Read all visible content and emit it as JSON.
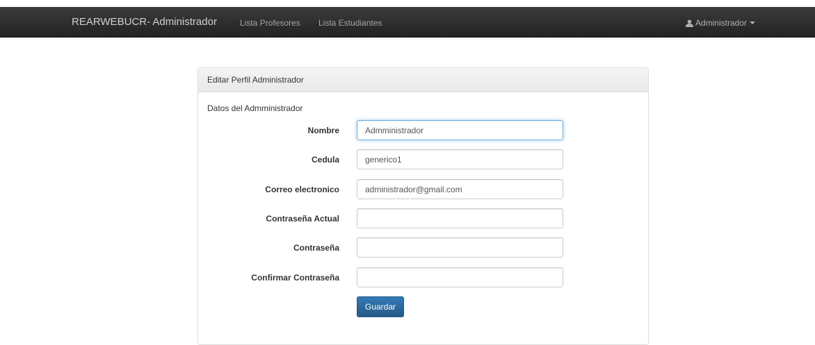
{
  "navbar": {
    "brand": "REARWEBUCR- Administrador",
    "links": [
      "Lista Profesores",
      "Lista Estudiantes"
    ],
    "user_menu": {
      "icon": "user-icon",
      "label": "Administrador"
    }
  },
  "panel": {
    "heading": "Editar Perfil Administrador",
    "section_title": "Datos del Admministrador",
    "fields": [
      {
        "label": "Nombre",
        "value": "Admministrador",
        "placeholder": ""
      },
      {
        "label": "Cedula",
        "value": "generico1",
        "placeholder": ""
      },
      {
        "label": "Correo electronico",
        "value": "administrador@gmail.com",
        "placeholder": ""
      },
      {
        "label": "Contraseña Actual",
        "value": "",
        "placeholder": ""
      },
      {
        "label": "Contraseña",
        "value": "",
        "placeholder": ""
      },
      {
        "label": "Confirmar Contraseña",
        "value": "",
        "placeholder": ""
      }
    ],
    "submit_label": "Guardar"
  },
  "colors": {
    "navbar_bg": "#222222",
    "primary": "#337ab7",
    "focus": "#66afe9"
  }
}
